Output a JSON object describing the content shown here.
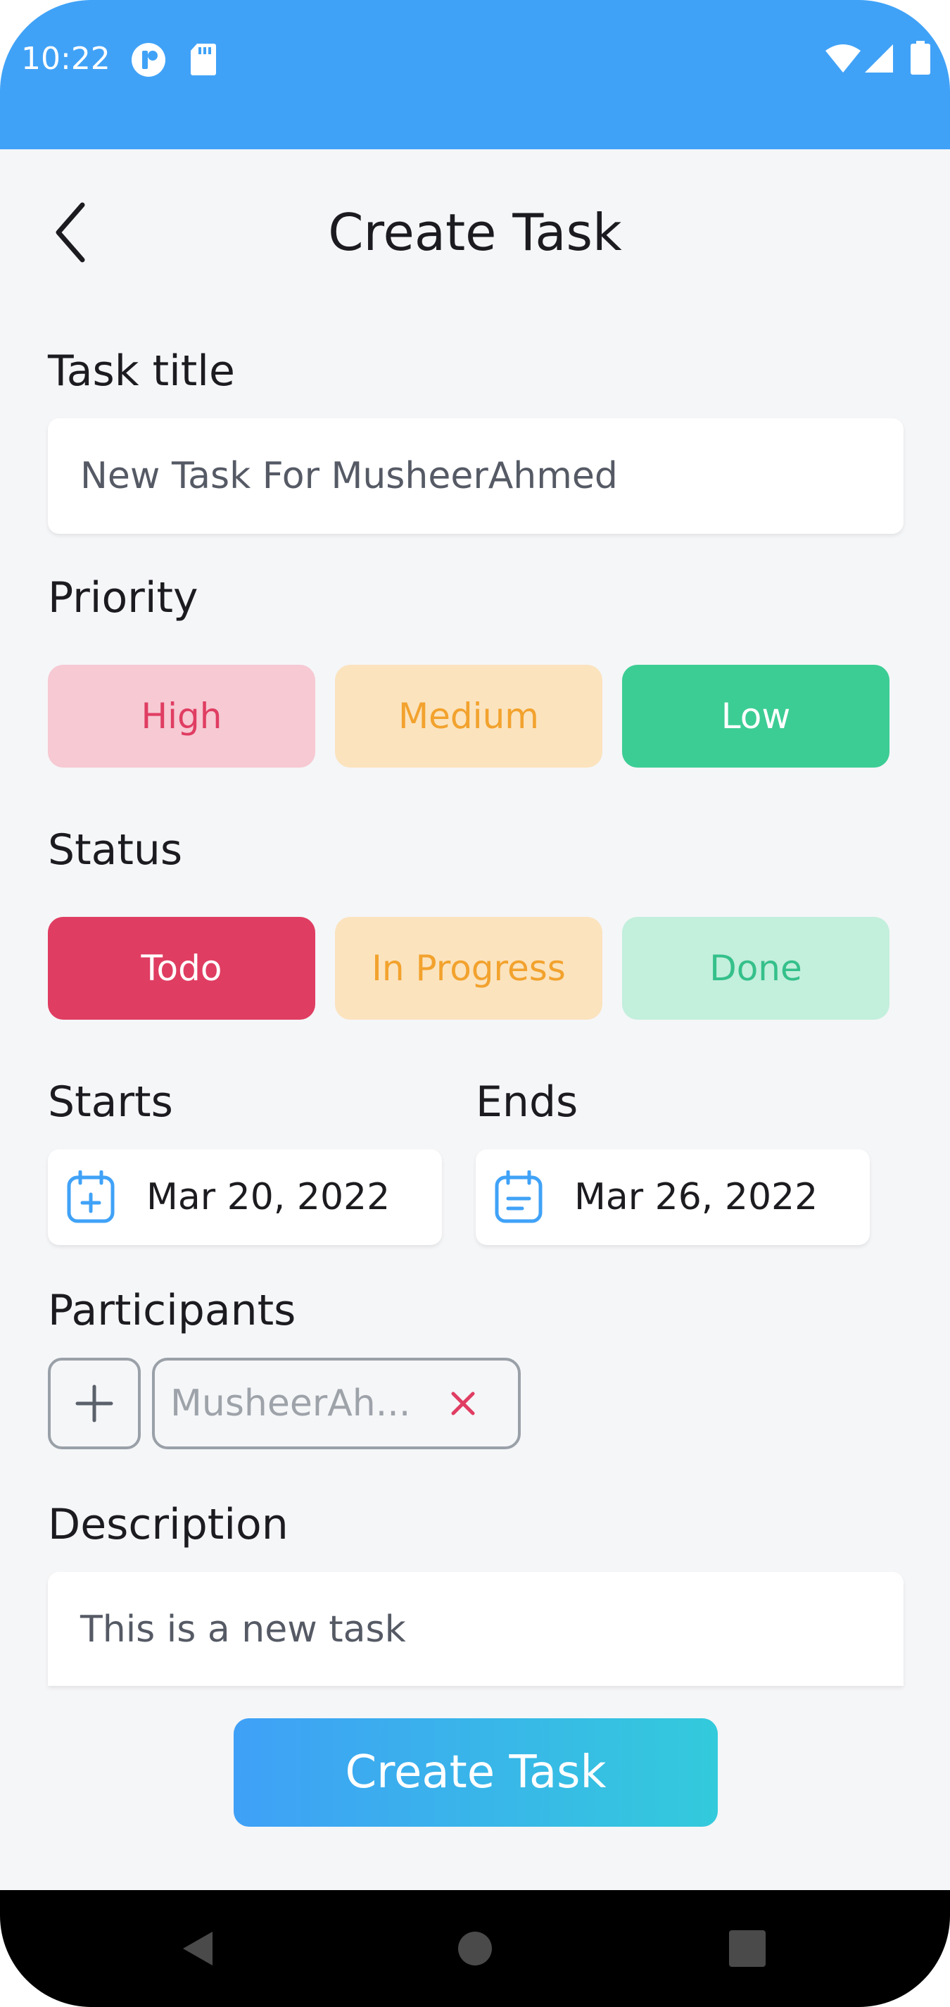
{
  "status_bar": {
    "time": "10:22",
    "bg_color": "#40a2f7",
    "icons": [
      "notification-icon",
      "sd-card-icon",
      "wifi-icon",
      "signal-icon",
      "battery-icon"
    ]
  },
  "header": {
    "back_icon": "chevron-left-icon",
    "title": "Create Task"
  },
  "task_title": {
    "label": "Task title",
    "value": "New Task For MusheerAhmed"
  },
  "priority": {
    "label": "Priority",
    "options": [
      {
        "label": "High",
        "bg": "#f6c9d3",
        "fg": "#e03d62",
        "selected": false
      },
      {
        "label": "Medium",
        "bg": "#fbe3be",
        "fg": "#f2a22d",
        "selected": false
      },
      {
        "label": "Low",
        "bg": "#3ccd94",
        "fg": "#ffffff",
        "selected": true
      }
    ]
  },
  "status": {
    "label": "Status",
    "options": [
      {
        "label": "Todo",
        "bg": "#e03d62",
        "fg": "#ffffff",
        "selected": true
      },
      {
        "label": "In Progress",
        "bg": "#fbe3be",
        "fg": "#f2a22d",
        "selected": false
      },
      {
        "label": "Done",
        "bg": "#c3efdd",
        "fg": "#35c08a",
        "selected": false
      }
    ]
  },
  "dates": {
    "starts_label": "Starts",
    "starts_value": "Mar 20, 2022",
    "ends_label": "Ends",
    "ends_value": "Mar 26, 2022"
  },
  "participants": {
    "label": "Participants",
    "items": [
      {
        "name": "MusheerAh..."
      }
    ]
  },
  "description": {
    "label": "Description",
    "value": "This is a new task"
  },
  "actions": {
    "create_label": "Create Task"
  },
  "nav_bar": {
    "icons": [
      "back-nav-icon",
      "home-nav-icon",
      "recents-nav-icon"
    ]
  }
}
